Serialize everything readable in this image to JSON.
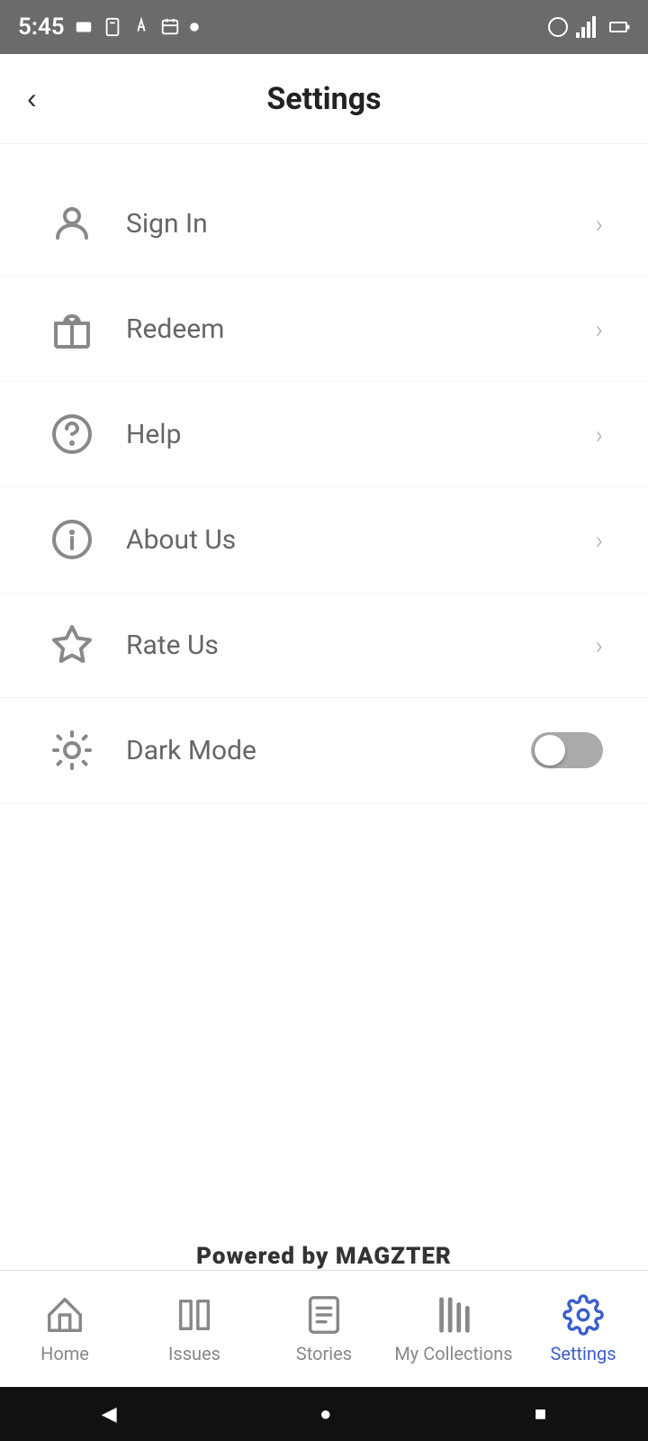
{
  "statusBar": {
    "time": "5:45"
  },
  "header": {
    "title": "Settings",
    "backLabel": "<"
  },
  "settingsItems": [
    {
      "id": "sign-in",
      "label": "Sign In",
      "type": "chevron",
      "icon": "person"
    },
    {
      "id": "redeem",
      "label": "Redeem",
      "type": "chevron",
      "icon": "gift"
    },
    {
      "id": "help",
      "label": "Help",
      "type": "chevron",
      "icon": "help-circle"
    },
    {
      "id": "about-us",
      "label": "About Us",
      "type": "chevron",
      "icon": "info"
    },
    {
      "id": "rate-us",
      "label": "Rate Us",
      "type": "chevron",
      "icon": "star"
    },
    {
      "id": "dark-mode",
      "label": "Dark Mode",
      "type": "toggle",
      "icon": "sun",
      "value": false
    }
  ],
  "poweredBy": {
    "prefix": "Powered by ",
    "brand": "MAGZTER"
  },
  "bottomNav": [
    {
      "id": "home",
      "label": "Home",
      "active": false
    },
    {
      "id": "issues",
      "label": "Issues",
      "active": false
    },
    {
      "id": "stories",
      "label": "Stories",
      "active": false
    },
    {
      "id": "my-collections",
      "label": "My Collections",
      "active": false
    },
    {
      "id": "settings",
      "label": "Settings",
      "active": true
    }
  ]
}
